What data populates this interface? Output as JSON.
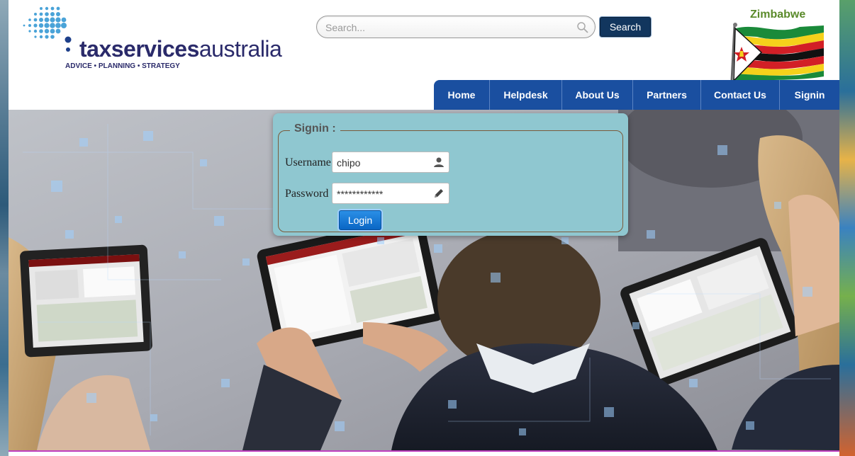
{
  "brand": {
    "name_bold": "taxservices",
    "name_light": "australia",
    "tagline": "ADVICE • PLANNING • STRATEGY"
  },
  "search": {
    "placeholder": "Search...",
    "value": "",
    "button_label": "Search",
    "icon": "magnifier-icon"
  },
  "country": {
    "name": "Zimbabwe",
    "flag_colors": [
      "#1a8a3a",
      "#f5d11b",
      "#d21f26",
      "#111111",
      "#ffffff"
    ]
  },
  "nav": {
    "items": [
      {
        "label": "Home"
      },
      {
        "label": "Helpdesk"
      },
      {
        "label": "About Us"
      },
      {
        "label": "Partners"
      },
      {
        "label": "Contact Us"
      },
      {
        "label": "Signin"
      }
    ]
  },
  "signin": {
    "legend": "Signin :",
    "username_label": "Username",
    "username_value": "chipo",
    "username_icon": "user-icon",
    "password_label": "Password",
    "password_value": "************",
    "password_icon": "pencil-icon",
    "login_label": "Login"
  },
  "colors": {
    "nav_bg": "#1a4fa0",
    "search_btn_bg": "#12365e",
    "signin_panel_bg": "#8fc7d0",
    "login_btn_bg": "#0a66c4",
    "brand_text": "#2a2a6a",
    "country_text": "#5a8a2a"
  }
}
